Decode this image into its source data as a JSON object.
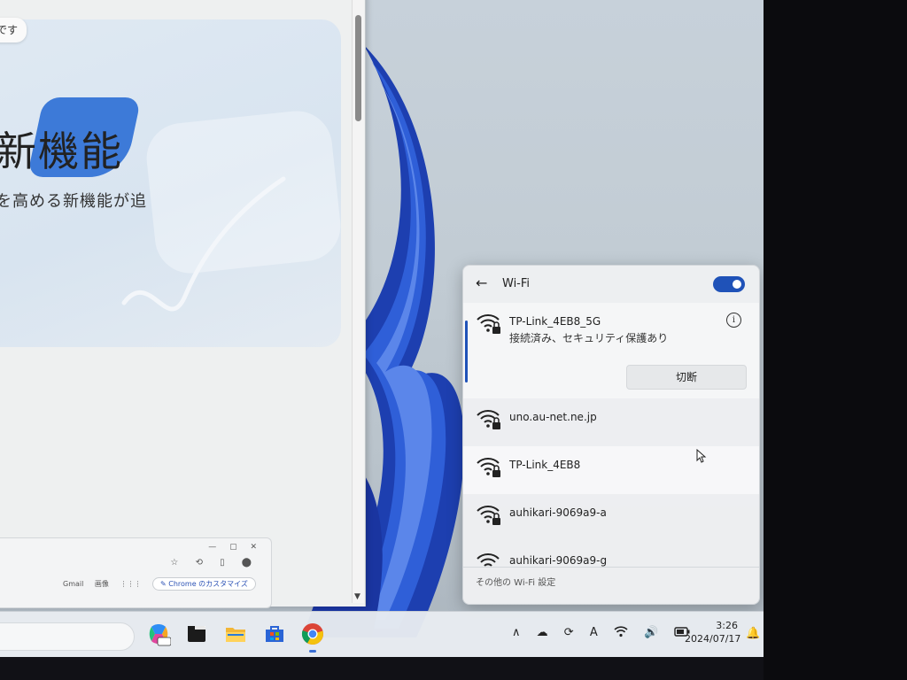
{
  "browser": {
    "chip_text": "です",
    "hero_title": "新機能",
    "hero_subtitle": "を高める新機能が追",
    "mini_window": {
      "tools": "☆ ⟲ ▯ ⬤",
      "bar_items": [
        "Gmail",
        "画像",
        "⋮⋮⋮"
      ],
      "customize_label": "✎ Chrome のカスタマイズ"
    }
  },
  "wifi_panel": {
    "title": "Wi-Fi",
    "toggle_on": true,
    "networks": [
      {
        "name": "TP-Link_4EB8_5G",
        "status": "接続済み、セキュリティ保護あり",
        "connected": true
      },
      {
        "name": "uno.au-net.ne.jp",
        "status": "",
        "connected": false
      },
      {
        "name": "TP-Link_4EB8",
        "status": "",
        "connected": false
      },
      {
        "name": "auhikari-9069a9-a",
        "status": "",
        "connected": false
      },
      {
        "name": "auhikari-9069a9-g",
        "status": "",
        "connected": false
      }
    ],
    "disconnect_label": "切断",
    "more_settings_label": "その他の Wi-Fi 設定"
  },
  "taskbar": {
    "apps": [
      "copilot-icon",
      "terminal-icon",
      "file-explorer-icon",
      "microsoft-store-icon",
      "chrome-icon"
    ],
    "tray": {
      "chevron": "∧",
      "ime": "A"
    },
    "clock": {
      "time": "3:26",
      "date": "2024/07/17"
    }
  },
  "colors": {
    "accent": "#1f52b8",
    "taskbar_indicator": "#3b70d6"
  }
}
